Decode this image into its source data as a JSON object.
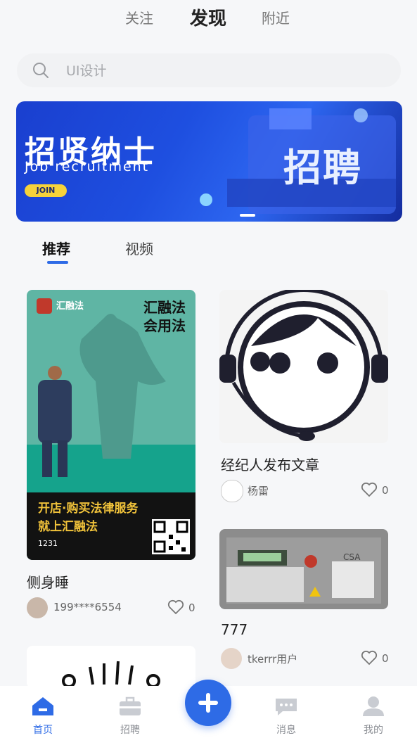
{
  "top_tabs": {
    "follow": "关注",
    "discover": "发现",
    "nearby": "附近"
  },
  "search": {
    "placeholder": "UI设计",
    "icon": "search-icon"
  },
  "banner": {
    "title": "招贤纳士",
    "subtitle": "Job recruitment",
    "button": "JOIN",
    "side_text": "招聘"
  },
  "content_tabs": {
    "recommend": "推荐",
    "video": "视频"
  },
  "cards": [
    {
      "title": "侧身睡",
      "author": "199****6554",
      "likes": "0",
      "poster": {
        "brand": "汇融法",
        "slogan_line1": "汇融法",
        "slogan_line2": "会用法",
        "promo_line1": "开店·购买法律服务",
        "promo_line2": "就上汇融法",
        "user": "1231"
      }
    },
    {
      "title": "经纪人发布文章",
      "author": "杨雷",
      "likes": "0"
    },
    {
      "title": "777",
      "author": "tkerrr用户",
      "likes": "0"
    }
  ],
  "bottom_nav": [
    {
      "label": "首页",
      "icon": "home-icon",
      "active": true
    },
    {
      "label": "招聘",
      "icon": "briefcase-icon",
      "active": false
    },
    {
      "label": "",
      "icon": "plus-icon",
      "active": false
    },
    {
      "label": "消息",
      "icon": "message-icon",
      "active": false
    },
    {
      "label": "我的",
      "icon": "user-icon",
      "active": false
    }
  ],
  "colors": {
    "accent": "#2e6be6",
    "background": "#f6f7f9"
  }
}
